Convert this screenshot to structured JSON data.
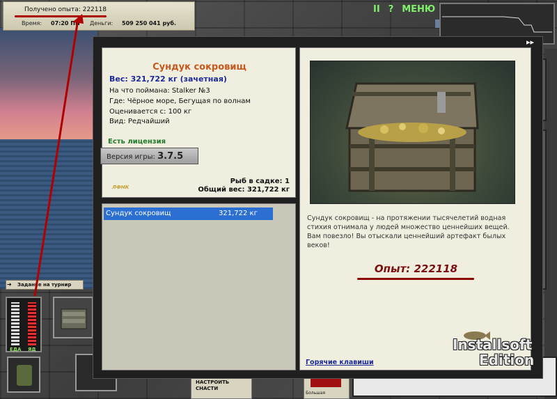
{
  "top_panel": {
    "xp_label": "Получено опыта: 222118",
    "time_label": "Время:",
    "time_value": "07:20 ПН",
    "money_label": "Деньги:",
    "money_value": "509 250 041 руб."
  },
  "menu": {
    "pause": "II",
    "help": "?",
    "menu": "МЕНЮ",
    "fast_forward": "▸▸"
  },
  "hud": {
    "tournament": "Задание на турнир",
    "food_label": "ЕДА",
    "poison_label": "ЯД"
  },
  "catch": {
    "title": "Сундук сокровищ",
    "weight": "Вес: 321,722 кг (зачетная)",
    "caught_with": "На что поймана: Stalker №3",
    "location": "Где: Чёрное море, Бегущая по волнам",
    "valued_from": "Оценивается с: 100 кг",
    "kind": "Вид: Редчайший",
    "license": "Есть лицензия",
    "version_label": "Версия игры:",
    "version_value": "3.7.5",
    "keeper_count": "Рыб в садке: 1",
    "total_weight": "Общий вес: 321,722 кг",
    "logo": "ЛФНК"
  },
  "keeper_list": [
    {
      "name": "Сундук сокровищ",
      "weight": "321,722 кг"
    }
  ],
  "description": {
    "text": "Сундук сокровищ - на протяжении тысячелетий водная стихия отнимала у людей множество ценнейших вещей. Вам повезло! Вы отыскали ценнейший артефакт былых веков!",
    "xp": "Опыт: 222118",
    "hotkeys": "Горячие клавиши"
  },
  "bottom": {
    "tune_tackle": "НАСТРОИТЬ СНАСТИ",
    "big_label": "Большая"
  },
  "watermark": {
    "line1": "Installsoft",
    "line2": "Edition"
  }
}
